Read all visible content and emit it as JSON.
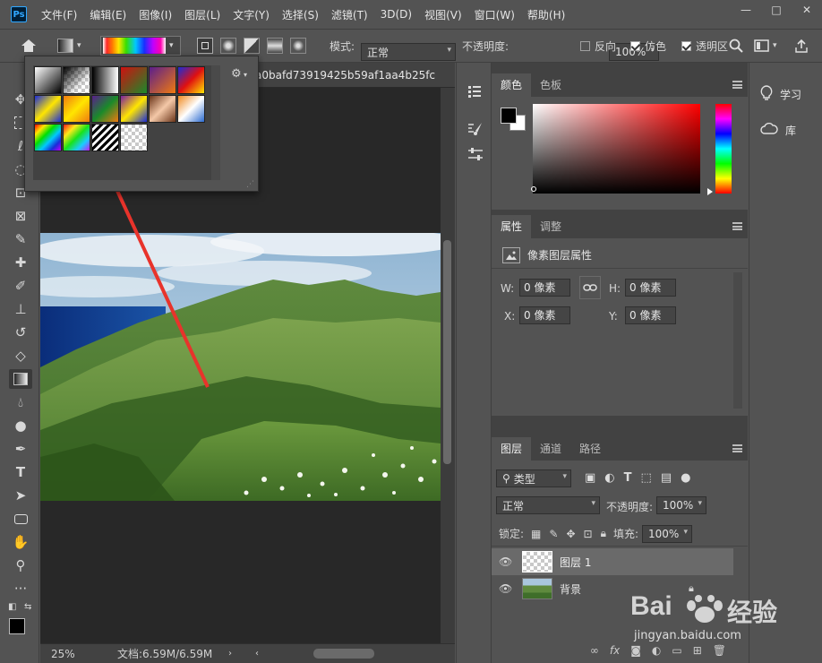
{
  "app": {
    "logo": "Ps"
  },
  "menubar": {
    "items": [
      "文件(F)",
      "编辑(E)",
      "图像(I)",
      "图层(L)",
      "文字(Y)",
      "选择(S)",
      "滤镜(T)",
      "3D(D)",
      "视图(V)",
      "窗口(W)",
      "帮助(H)"
    ],
    "window_controls": {
      "minimize": "—",
      "restore": "□",
      "close": "✕"
    }
  },
  "options": {
    "mode_label": "模式:",
    "mode_value": "正常",
    "opacity_label": "不透明度:",
    "opacity_value": "100%",
    "reverse_label": "反向",
    "dither_label": "仿色",
    "transparency_label": "透明区",
    "reverse_checked": false,
    "dither_checked": true,
    "transparency_checked": true
  },
  "gradient_picker": {
    "gear": "⚙",
    "grid_rows": 3,
    "grid_cols": 6
  },
  "document": {
    "tab_title": "a0bafd73919425b59af1aa4b25fc",
    "zoom": "25%",
    "doc_size": "文档:6.59M/6.59M"
  },
  "color_panel": {
    "tabs": [
      "颜色",
      "色板"
    ],
    "base_hue": "#ff0000"
  },
  "properties_panel": {
    "tabs": [
      "属性",
      "调整"
    ],
    "title": "像素图层属性",
    "w_label": "W:",
    "w_value": "0 像素",
    "h_label": "H:",
    "h_value": "0 像素",
    "x_label": "X:",
    "x_value": "0 像素",
    "y_label": "Y:",
    "y_value": "0 像素"
  },
  "layers_panel": {
    "tabs": [
      "图层",
      "通道",
      "路径"
    ],
    "filter_label": "类型",
    "blend_mode": "正常",
    "opacity_label": "不透明度:",
    "opacity_value": "100%",
    "lock_label": "锁定:",
    "fill_label": "填充:",
    "fill_value": "100%",
    "layers": [
      {
        "name": "图层 1",
        "selected": true
      },
      {
        "name": "背景",
        "selected": false
      }
    ],
    "footer_icons": [
      "link-icon",
      "fx-icon",
      "mask-icon",
      "adjustment-icon",
      "group-icon",
      "new-layer-icon",
      "trash-icon"
    ]
  },
  "learn_panel": {
    "items": [
      "学习",
      "库"
    ]
  },
  "watermark": {
    "brand": "Bai",
    "brand2": "经验",
    "url": "jingyan.baidu.com"
  },
  "annotation": {
    "color": "#e8332b"
  }
}
